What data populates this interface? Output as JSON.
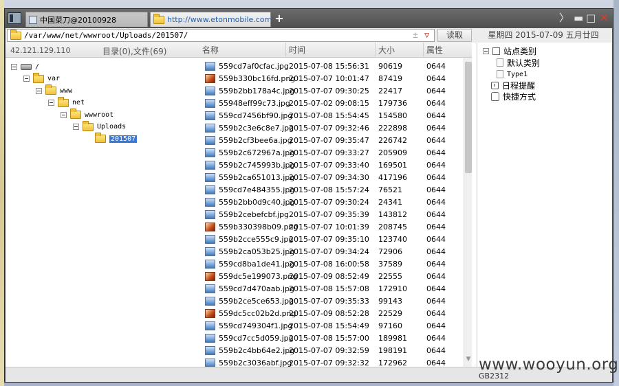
{
  "tabs": [
    {
      "label": "中国菜刀@20100928"
    },
    {
      "label": "http://www.etonmobile.com/..."
    }
  ],
  "window_controls": {
    "new_tab": "+",
    "chevron": "〉",
    "minimize": "▬",
    "maximize": "□",
    "close": "✕"
  },
  "address": {
    "path": "/var/www/net/wwwroot/Uploads/201507/",
    "plus": "±",
    "dropdown": "▽"
  },
  "read_button": "读取",
  "date_label": "星期四 2015-07-09 五月廿四",
  "left_panel": {
    "ip": "42.121.129.110",
    "count": "目录(0),文件(69)",
    "tree": [
      {
        "label": "/",
        "type": "drive"
      },
      {
        "label": "var",
        "type": "folder"
      },
      {
        "label": "www",
        "type": "folder"
      },
      {
        "label": "net",
        "type": "folder"
      },
      {
        "label": "wwwroot",
        "type": "folder"
      },
      {
        "label": "Uploads",
        "type": "folder"
      },
      {
        "label": "201507",
        "type": "folder-selected"
      }
    ]
  },
  "file_list": {
    "columns": [
      "名称",
      "时间",
      "大小",
      "属性"
    ],
    "rows": [
      {
        "name": "559cd7af0cfac.jpg",
        "time": "2015-07-08 15:56:31",
        "size": "90619",
        "attr": "0644",
        "kind": "jpg"
      },
      {
        "name": "559b330bc16fd.png",
        "time": "2015-07-07 10:01:47",
        "size": "87419",
        "attr": "0644",
        "kind": "png"
      },
      {
        "name": "559b2bb178a4c.jpg",
        "time": "2015-07-07 09:30:25",
        "size": "22417",
        "attr": "0644",
        "kind": "jpg"
      },
      {
        "name": "55948eff99c73.jpg",
        "time": "2015-07-02 09:08:15",
        "size": "179736",
        "attr": "0644",
        "kind": "jpg"
      },
      {
        "name": "559cd7456bf90.jpg",
        "time": "2015-07-08 15:54:45",
        "size": "154580",
        "attr": "0644",
        "kind": "jpg"
      },
      {
        "name": "559b2c3e6c8e7.jpg",
        "time": "2015-07-07 09:32:46",
        "size": "222898",
        "attr": "0644",
        "kind": "jpg"
      },
      {
        "name": "559b2cf3bee6a.jpg",
        "time": "2015-07-07 09:35:47",
        "size": "226742",
        "attr": "0644",
        "kind": "jpg"
      },
      {
        "name": "559b2c672967a.jpg",
        "time": "2015-07-07 09:33:27",
        "size": "205909",
        "attr": "0644",
        "kind": "jpg"
      },
      {
        "name": "559b2c745993b.jpg",
        "time": "2015-07-07 09:33:40",
        "size": "169501",
        "attr": "0644",
        "kind": "jpg"
      },
      {
        "name": "559b2ca651013.jpg",
        "time": "2015-07-07 09:34:30",
        "size": "417196",
        "attr": "0644",
        "kind": "jpg"
      },
      {
        "name": "559cd7e484355.jpg",
        "time": "2015-07-08 15:57:24",
        "size": "76521",
        "attr": "0644",
        "kind": "jpg"
      },
      {
        "name": "559b2bb0d9c40.jpg",
        "time": "2015-07-07 09:30:24",
        "size": "24341",
        "attr": "0644",
        "kind": "jpg"
      },
      {
        "name": "559b2cebefcbf.jpg",
        "time": "2015-07-07 09:35:39",
        "size": "143812",
        "attr": "0644",
        "kind": "jpg"
      },
      {
        "name": "559b330398b09.png",
        "time": "2015-07-07 10:01:39",
        "size": "208745",
        "attr": "0644",
        "kind": "png"
      },
      {
        "name": "559b2cce555c9.jpg",
        "time": "2015-07-07 09:35:10",
        "size": "123740",
        "attr": "0644",
        "kind": "jpg"
      },
      {
        "name": "559b2ca053b25.jpg",
        "time": "2015-07-07 09:34:24",
        "size": "72906",
        "attr": "0644",
        "kind": "jpg"
      },
      {
        "name": "559cd8ba1de41.jpg",
        "time": "2015-07-08 16:00:58",
        "size": "37589",
        "attr": "0644",
        "kind": "jpg"
      },
      {
        "name": "559dc5e199073.png",
        "time": "2015-07-09 08:52:49",
        "size": "22555",
        "attr": "0644",
        "kind": "png"
      },
      {
        "name": "559cd7d470aab.jpg",
        "time": "2015-07-08 15:57:08",
        "size": "172910",
        "attr": "0644",
        "kind": "jpg"
      },
      {
        "name": "559b2ce5ce653.jpg",
        "time": "2015-07-07 09:35:33",
        "size": "99143",
        "attr": "0644",
        "kind": "jpg"
      },
      {
        "name": "559dc5cc02b2d.png",
        "time": "2015-07-09 08:52:28",
        "size": "22529",
        "attr": "0644",
        "kind": "png"
      },
      {
        "name": "559cd749304f1.jpg",
        "time": "2015-07-08 15:54:49",
        "size": "97160",
        "attr": "0644",
        "kind": "jpg"
      },
      {
        "name": "559cd7cc5d059.jpg",
        "time": "2015-07-08 15:57:00",
        "size": "189981",
        "attr": "0644",
        "kind": "jpg"
      },
      {
        "name": "559b2c4bb64e2.jpg",
        "time": "2015-07-07 09:32:59",
        "size": "198191",
        "attr": "0644",
        "kind": "jpg"
      },
      {
        "name": "559b2c3036abf.jpg",
        "time": "2015-07-07 09:32:32",
        "size": "172962",
        "attr": "0644",
        "kind": "jpg"
      }
    ]
  },
  "right_panel": {
    "items": [
      {
        "label": "站点类别",
        "icon": "checkbox-icon"
      },
      {
        "label": "默认类别",
        "icon": "document-icon"
      },
      {
        "label": "Type1",
        "icon": "document-icon"
      },
      {
        "label": "日程提醒",
        "icon": "clock-icon"
      },
      {
        "label": "快捷方式",
        "icon": "hand-icon"
      }
    ]
  },
  "status": {
    "encoding": "GB2312"
  },
  "watermark": "www.wooyun.org",
  "colors": {
    "selection": "#3a78d4",
    "close": "#e23a2a",
    "url_text": "#2a5ea8"
  }
}
